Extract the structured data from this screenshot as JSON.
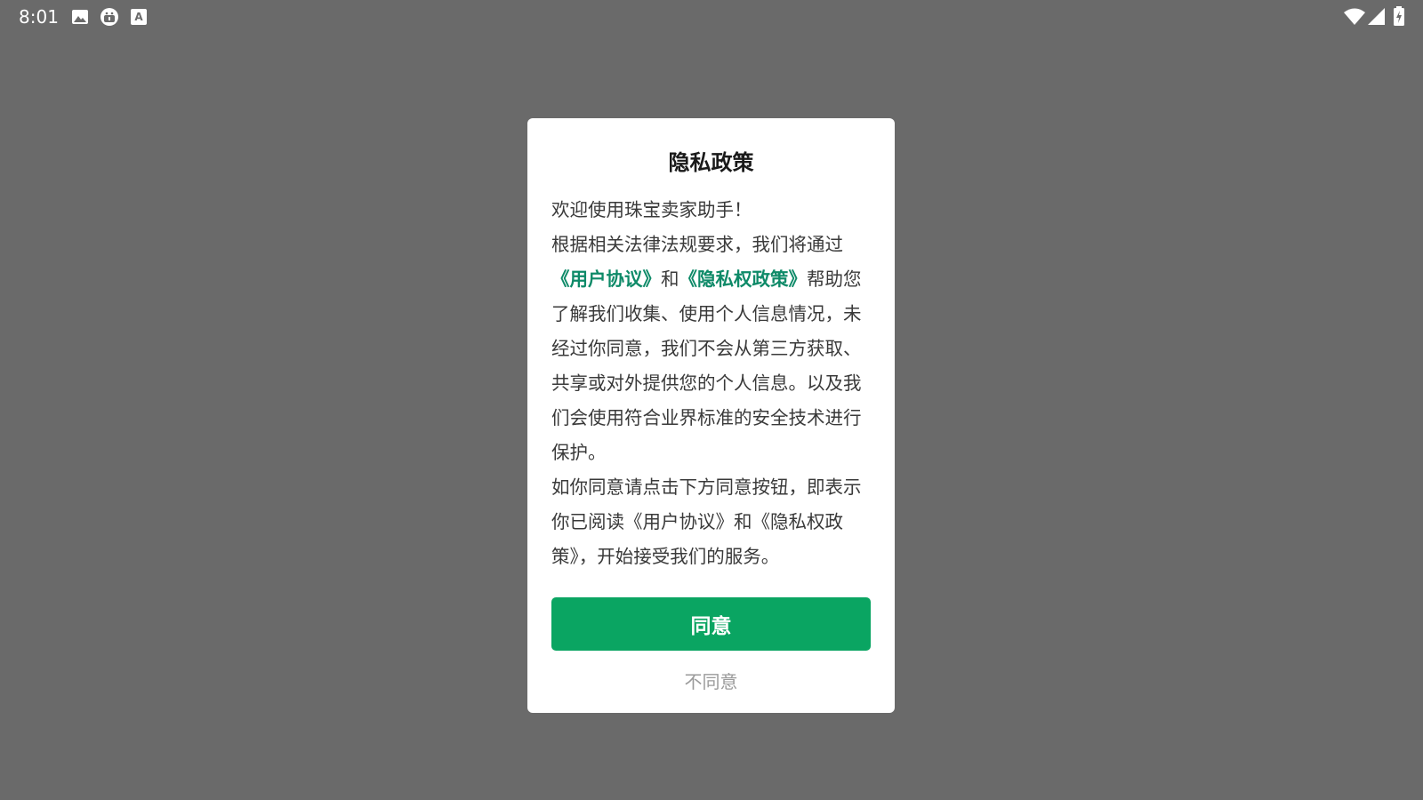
{
  "status_bar": {
    "time": "8:01",
    "left_icons": [
      "image-icon",
      "android-debug-icon",
      "keyboard-a-icon"
    ],
    "right_icons": [
      "wifi-icon",
      "cellular-signal-icon",
      "battery-charging-icon"
    ]
  },
  "dialog": {
    "title": "隐私政策",
    "welcome": "欢迎使用珠宝卖家助手！",
    "paragraph1_prefix": "根据相关法律法规要求，我们将通过",
    "user_agreement_link": "《用户协议》",
    "conjunction": "和",
    "privacy_policy_link": "《隐私权政策》",
    "paragraph1_suffix": "帮助您了解我们收集、使用个人信息情况，未经过你同意，我们不会从第三方获取、共享或对外提供您的个人信息。以及我们会使用符合业界标准的安全技术进行保护。",
    "paragraph2": "如你同意请点击下方同意按钮，即表示你已阅读《用户协议》和《隐私权政策》，开始接受我们的服务。",
    "agree_label": "同意",
    "disagree_label": "不同意"
  },
  "colors": {
    "overlay": "#6a6a6a",
    "link": "#0e8a68",
    "agree_button": "#0aa562",
    "disagree_text": "#9a9a9a"
  }
}
